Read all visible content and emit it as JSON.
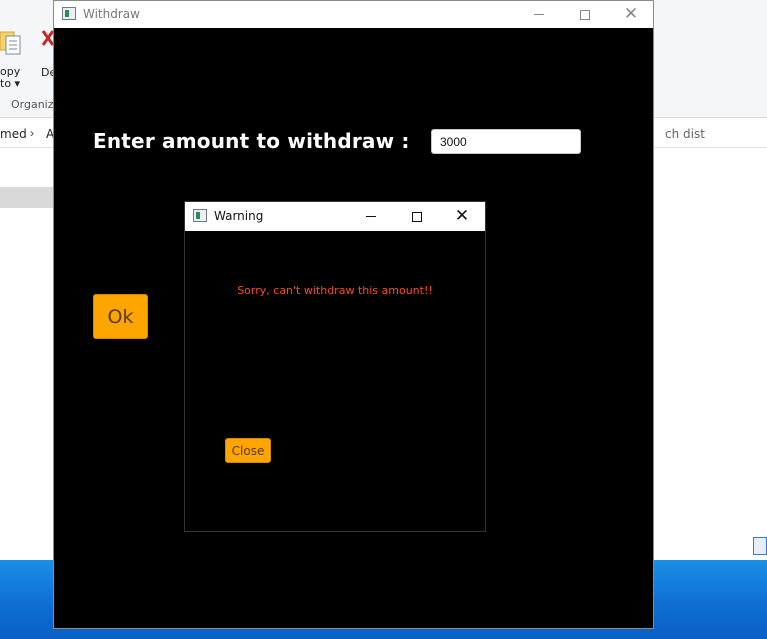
{
  "background": {
    "copy_label": "opy\nto ▾",
    "delete_label": "De",
    "group_label": "Organiz",
    "breadcrumb_text": "med",
    "breadcrumb_separator": "›",
    "breadcrumb_next": "A",
    "search_text": "ch dist"
  },
  "withdraw_window": {
    "title": "Withdraw",
    "prompt": "Enter amount to withdraw :",
    "amount_value": "3000",
    "ok_label": "Ok",
    "colors": {
      "background": "#000000",
      "button": "#ffa500"
    }
  },
  "warning_dialog": {
    "title": "Warning",
    "message": "Sorry, can't withdraw this amount!!",
    "close_label": "Close",
    "colors": {
      "message": "#ff4a1a",
      "button": "#ffa500"
    }
  },
  "icons": {
    "minimize": "minimize-icon",
    "maximize": "maximize-icon",
    "close": "close-icon",
    "close_glyph": "✕"
  }
}
